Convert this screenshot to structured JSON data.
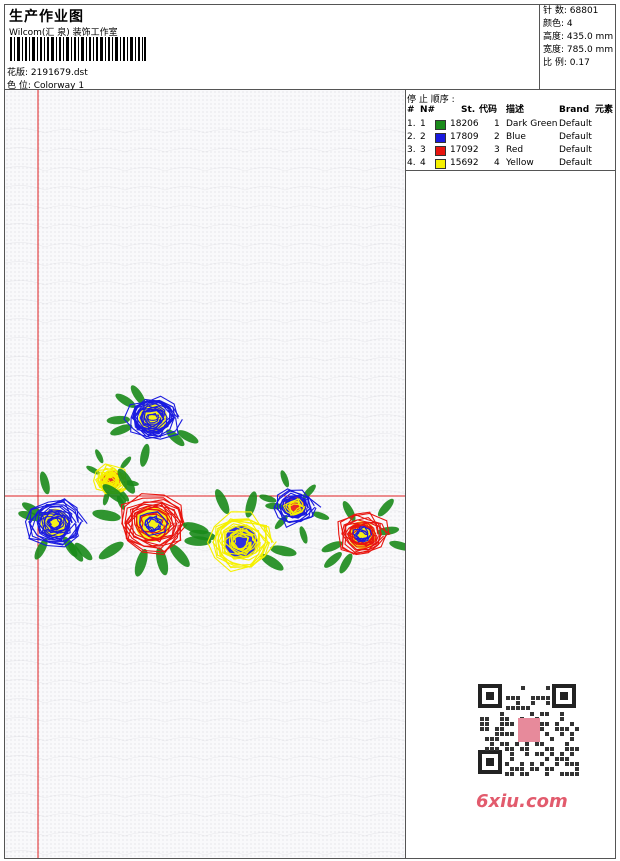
{
  "header": {
    "title": "生产作业图",
    "studio": "Wilcom(汇 泉) 装饰工作室",
    "design_file": "花版:  2191679.dst",
    "colorway": "色 位:  Colorway 1"
  },
  "stats": [
    {
      "label": "针 数:",
      "value": "68801"
    },
    {
      "label": "颜色:",
      "value": "4"
    },
    {
      "label": "高度:",
      "value": "435.0 mm"
    },
    {
      "label": "宽度:",
      "value": "785.0 mm"
    },
    {
      "label": "比 例:",
      "value": "0.17"
    }
  ],
  "stop_sequence": {
    "title": "停 止 顺序 :",
    "headers": {
      "num": "#",
      "n": "N#",
      "st": "St.",
      "code": "代码",
      "desc": "描述",
      "brand": "Brand",
      "element": "元素"
    },
    "rows": [
      {
        "num": "1.",
        "n": "1",
        "color": "#1a8a1a",
        "st": "18206",
        "code": "1",
        "desc": "Dark Green",
        "brand": "Default"
      },
      {
        "num": "2.",
        "n": "2",
        "color": "#1a1adf",
        "st": "17809",
        "code": "2",
        "desc": "Blue",
        "brand": "Default"
      },
      {
        "num": "3.",
        "n": "3",
        "color": "#e8150f",
        "st": "17092",
        "code": "3",
        "desc": "Red",
        "brand": "Default"
      },
      {
        "num": "4.",
        "n": "4",
        "color": "#f5f000",
        "st": "15692",
        "code": "4",
        "desc": "Yellow",
        "brand": "Default"
      }
    ]
  },
  "watermark": {
    "text": "6xiu.com"
  },
  "colors": {
    "green": "#1a8a1a",
    "blue": "#1a1adf",
    "red": "#e8150f",
    "yellow": "#f5f000",
    "guide": "#e02020"
  }
}
